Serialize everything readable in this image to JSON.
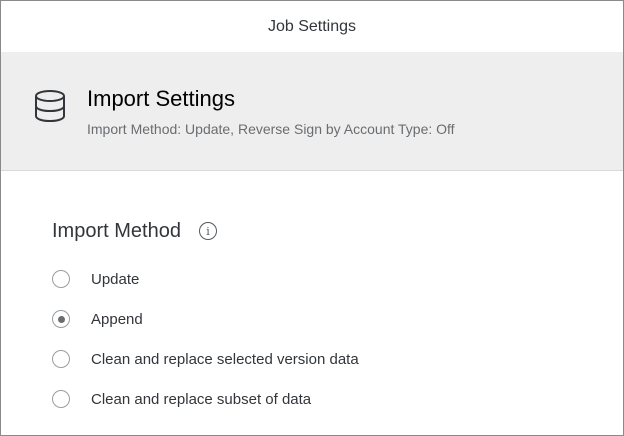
{
  "dialog": {
    "title": "Job Settings"
  },
  "section": {
    "icon": "database-icon",
    "title": "Import Settings",
    "subtitle": "Import Method: Update, Reverse Sign by Account Type: Off"
  },
  "import_method": {
    "label": "Import Method",
    "info_icon": "info-icon",
    "info_glyph": "i",
    "selected": "Append",
    "options": [
      {
        "label": "Update",
        "selected": false
      },
      {
        "label": "Append",
        "selected": true
      },
      {
        "label": "Clean and replace selected version data",
        "selected": false
      },
      {
        "label": "Clean and replace subset of data",
        "selected": false
      }
    ]
  }
}
